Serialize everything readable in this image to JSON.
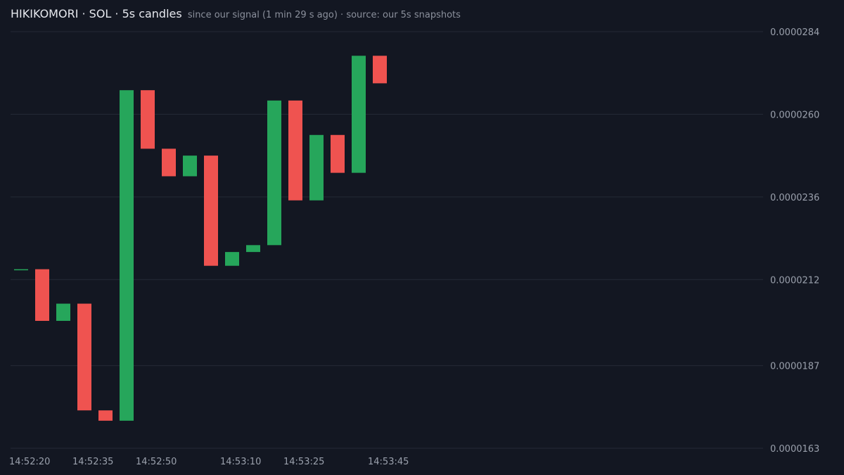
{
  "header": {
    "title": "HIKIKOMORI · SOL · 5s candles",
    "subtitle": "since our signal (1 min 29 s ago) · source: our 5s snapshots"
  },
  "colors": {
    "background": "#131722",
    "up": "#26a65b",
    "down": "#ef5350",
    "grid": "#252a36",
    "text": "#9aa0ac"
  },
  "chart_data": {
    "type": "candlestick",
    "title": "HIKIKOMORI · SOL · 5s candles",
    "subtitle": "since our signal (1 min 29 s ago) · source: our 5s snapshots",
    "interval_seconds": 5,
    "y_axis": {
      "position": "right",
      "range": [
        1.63e-05,
        2.84e-05
      ],
      "ticks": [
        "0.0000163",
        "0.0000187",
        "0.0000212",
        "0.0000236",
        "0.0000260",
        "0.0000284"
      ],
      "grid": true
    },
    "x_axis": {
      "ticks": [
        "14:52:20",
        "14:52:35",
        "14:52:50",
        "14:53:10",
        "14:53:25",
        "14:53:45"
      ],
      "grid": false
    },
    "candles": [
      {
        "time": "14:52:20",
        "open": 2.15e-05,
        "close": 2.15e-05
      },
      {
        "time": "14:52:25",
        "open": 2.15e-05,
        "close": 2e-05
      },
      {
        "time": "14:52:30",
        "open": 2e-05,
        "close": 2.05e-05
      },
      {
        "time": "14:52:35",
        "open": 2.05e-05,
        "close": 1.74e-05
      },
      {
        "time": "14:52:40",
        "open": 1.74e-05,
        "close": 1.71e-05
      },
      {
        "time": "14:52:45",
        "open": 1.71e-05,
        "close": 2.67e-05
      },
      {
        "time": "14:52:50",
        "open": 2.67e-05,
        "close": 2.5e-05
      },
      {
        "time": "14:52:55",
        "open": 2.5e-05,
        "close": 2.42e-05
      },
      {
        "time": "14:53:00",
        "open": 2.42e-05,
        "close": 2.48e-05
      },
      {
        "time": "14:53:05",
        "open": 2.48e-05,
        "close": 2.16e-05
      },
      {
        "time": "14:53:10",
        "open": 2.16e-05,
        "close": 2.2e-05
      },
      {
        "time": "14:53:15",
        "open": 2.2e-05,
        "close": 2.22e-05
      },
      {
        "time": "14:53:20",
        "open": 2.22e-05,
        "close": 2.64e-05
      },
      {
        "time": "14:53:25",
        "open": 2.64e-05,
        "close": 2.35e-05
      },
      {
        "time": "14:53:30",
        "open": 2.35e-05,
        "close": 2.54e-05
      },
      {
        "time": "14:53:35",
        "open": 2.54e-05,
        "close": 2.43e-05
      },
      {
        "time": "14:53:40",
        "open": 2.43e-05,
        "close": 2.77e-05
      },
      {
        "time": "14:53:45",
        "open": 2.77e-05,
        "close": 2.69e-05
      }
    ]
  }
}
